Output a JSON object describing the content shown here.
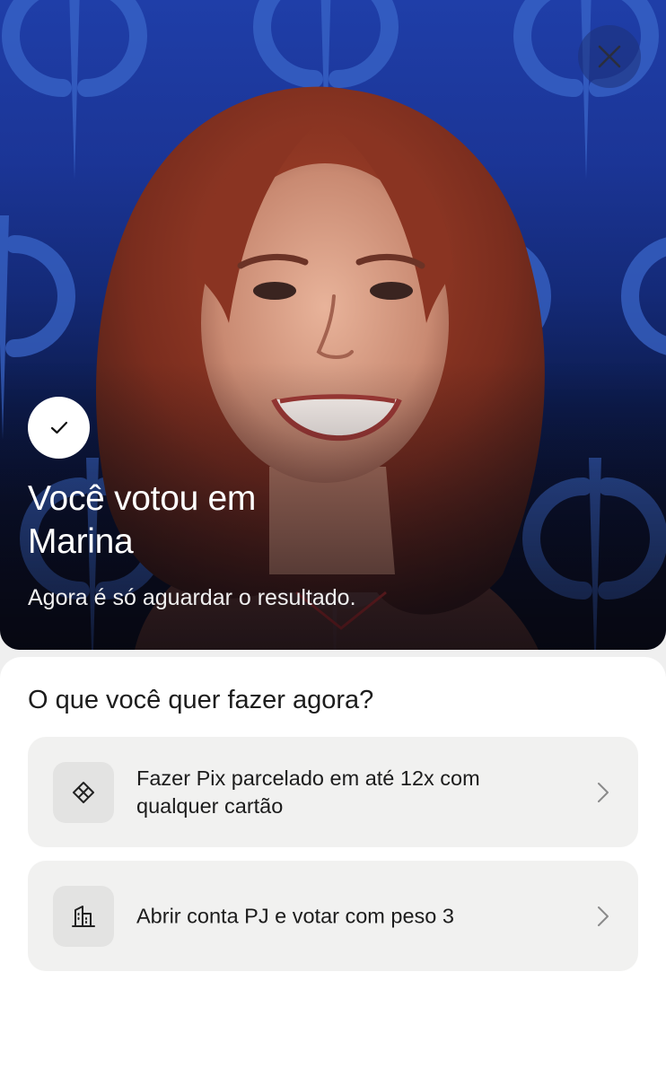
{
  "hero": {
    "title": "Você votou em Marina",
    "subtitle": "Agora é só aguardar o resultado.",
    "close_icon": "close-icon",
    "status_icon": "checkmark-icon",
    "background_color": "#1b3596"
  },
  "sheet": {
    "title": "O que você quer fazer agora?",
    "options": [
      {
        "label": "Fazer Pix parcelado em até 12x com qualquer cartão",
        "icon": "pix-icon"
      },
      {
        "label": "Abrir conta PJ e votar com peso 3",
        "icon": "building-icon"
      }
    ]
  }
}
